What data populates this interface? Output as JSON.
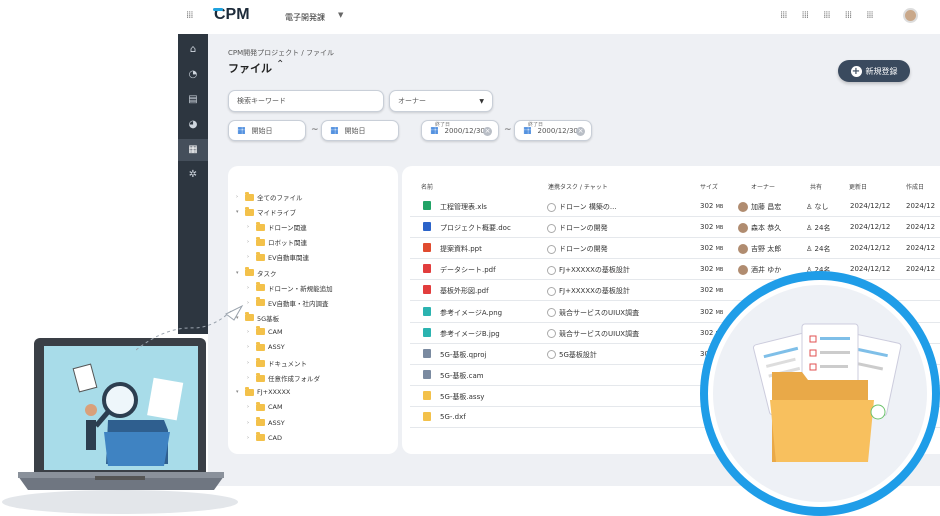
{
  "app": {
    "logo": "CPM",
    "department": "電子開発課"
  },
  "breadcrumb": "CPM開発プロジェクト / ファイル",
  "page_title": "ファイル",
  "new_button": "新規登録",
  "search": {
    "placeholder": "検索キーワード",
    "owner_placeholder": "オーナー"
  },
  "date_filters": {
    "start1": "開始日",
    "start2": "開始日",
    "end_label": "終了日",
    "end1": "2000/12/30",
    "end2": "2000/12/30"
  },
  "tree": [
    {
      "label": "全てのファイル",
      "level": 0,
      "open": false
    },
    {
      "label": "マイドライブ",
      "level": 0,
      "open": true
    },
    {
      "label": "ドローン関連",
      "level": 1,
      "open": false
    },
    {
      "label": "ロボット関連",
      "level": 1,
      "open": false
    },
    {
      "label": "EV自動車関連",
      "level": 1,
      "open": false
    },
    {
      "label": "タスク",
      "level": 0,
      "open": true
    },
    {
      "label": "ドローン・新規能追加",
      "level": 1,
      "open": false
    },
    {
      "label": "EV自動車・社内調査",
      "level": 1,
      "open": false
    },
    {
      "label": "5G基板",
      "level": 0,
      "open": true
    },
    {
      "label": "CAM",
      "level": 1,
      "open": false
    },
    {
      "label": "ASSY",
      "level": 1,
      "open": false
    },
    {
      "label": "ドキュメント",
      "level": 1,
      "open": false
    },
    {
      "label": "任意作成フォルダ",
      "level": 1,
      "open": false
    },
    {
      "label": "FJ+XXXXX",
      "level": 0,
      "open": true
    },
    {
      "label": "CAM",
      "level": 1,
      "open": false
    },
    {
      "label": "ASSY",
      "level": 1,
      "open": false
    },
    {
      "label": "CAD",
      "level": 1,
      "open": false
    }
  ],
  "columns": [
    "名前",
    "連携タスク / チャット",
    "サイズ",
    "オーナー",
    "共有",
    "更新日",
    "作成日"
  ],
  "files": [
    {
      "name": "工程管理表.xls",
      "icon": "excel",
      "color": "#21a366",
      "task": "ドローン 構築の...",
      "size": "302",
      "owner": "加藤 昌宏",
      "share": "なし",
      "updated": "2024/12/12",
      "created": "2024/12"
    },
    {
      "name": "プロジェクト概要.doc",
      "icon": "word",
      "color": "#2b63c9",
      "task": "ドローンの開発",
      "size": "302",
      "owner": "森本 恭久",
      "share": "24名",
      "updated": "2024/12/12",
      "created": "2024/12"
    },
    {
      "name": "提案資料.ppt",
      "icon": "ppt",
      "color": "#e04b2f",
      "task": "ドローンの開発",
      "size": "302",
      "owner": "吉野 太郎",
      "share": "24名",
      "updated": "2024/12/12",
      "created": "2024/12"
    },
    {
      "name": "データシート.pdf",
      "icon": "pdf",
      "color": "#e23d3d",
      "task": "FJ+XXXXXの基板設計",
      "size": "302",
      "owner": "酒井 ゆか",
      "share": "24名",
      "updated": "2024/12/12",
      "created": "2024/12"
    },
    {
      "name": "基板外形図.pdf",
      "icon": "pdf",
      "color": "#e23d3d",
      "task": "FJ+XXXXXの基板設計",
      "size": "302",
      "owner": "",
      "share": "",
      "updated": "",
      "created": ""
    },
    {
      "name": "参考イメージA.png",
      "icon": "image",
      "color": "#2bb3b0",
      "task": "競合サービスのUIUX調査",
      "size": "302",
      "owner": "",
      "share": "",
      "updated": "",
      "created": ""
    },
    {
      "name": "参考イメージB.jpg",
      "icon": "image",
      "color": "#2bb3b0",
      "task": "競合サービスのUIUX調査",
      "size": "302",
      "owner": "",
      "share": "",
      "updated": "",
      "created": ""
    },
    {
      "name": "5G-基板.qproj",
      "icon": "doc",
      "color": "#7a8aa0",
      "task": "5G基板設計",
      "size": "302",
      "owner": "",
      "share": "",
      "updated": "",
      "created": ""
    },
    {
      "name": "5G-基板.cam",
      "icon": "doc",
      "color": "#7a8aa0",
      "task": "",
      "size": "",
      "owner": "",
      "share": "",
      "updated": "",
      "created": ""
    },
    {
      "name": "5G-基板.assy",
      "icon": "folder",
      "color": "#f3c14a",
      "task": "",
      "size": "",
      "owner": "",
      "share": "",
      "updated": "",
      "created": ""
    },
    {
      "name": "5G-.dxf",
      "icon": "folder",
      "color": "#f3c14a",
      "task": "",
      "size": "",
      "owner": "",
      "share": "",
      "updated": "",
      "created": ""
    }
  ],
  "size_unit": "MB"
}
